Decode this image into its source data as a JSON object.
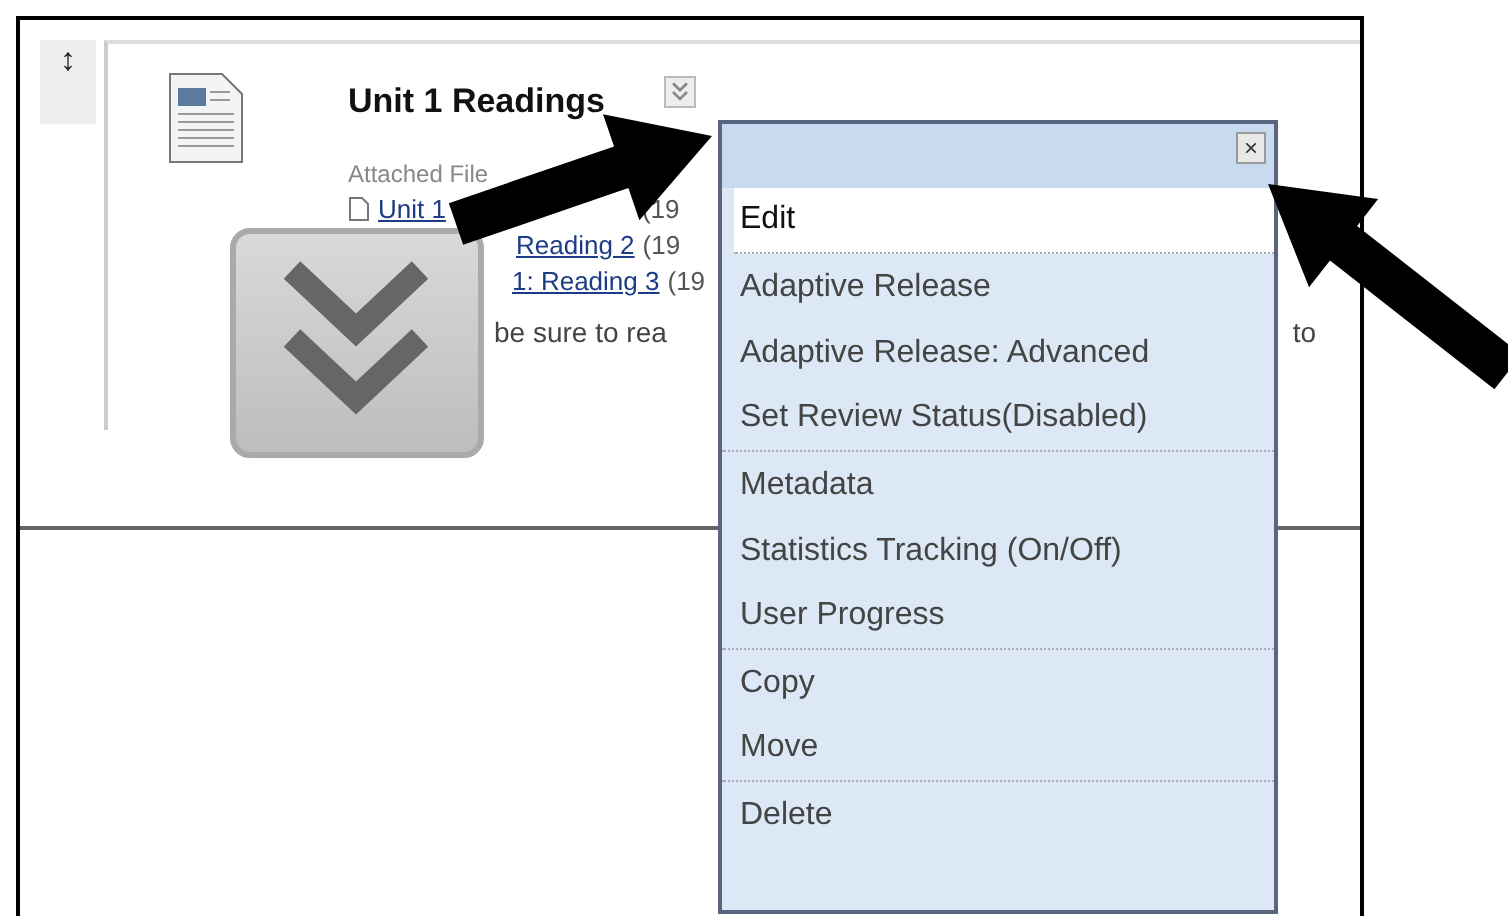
{
  "item": {
    "handle": "↕",
    "title": "Unit 1 Readings",
    "attached_label": "Attached File",
    "files": [
      {
        "name": "Unit 1",
        "size": "(19"
      },
      {
        "name": "Reading 2",
        "size": "(19"
      },
      {
        "name": "1: Reading 3",
        "size": "(19"
      }
    ],
    "description": "be sure to rea",
    "description_tail": "to"
  },
  "menu": {
    "close": "×",
    "items": [
      {
        "label": "Edit",
        "selected": true,
        "separator_after": true
      },
      {
        "label": "Adaptive Release",
        "selected": false,
        "separator_after": false
      },
      {
        "label": "Adaptive Release: Advanced",
        "selected": false,
        "separator_after": false
      },
      {
        "label": "Set Review Status(Disabled)",
        "selected": false,
        "separator_after": true
      },
      {
        "label": "Metadata",
        "selected": false,
        "separator_after": false
      },
      {
        "label": "Statistics Tracking (On/Off)",
        "selected": false,
        "separator_after": false
      },
      {
        "label": "User Progress",
        "selected": false,
        "separator_after": true
      },
      {
        "label": "Copy",
        "selected": false,
        "separator_after": false
      },
      {
        "label": "Move",
        "selected": false,
        "separator_after": true
      },
      {
        "label": "Delete",
        "selected": false,
        "separator_after": false
      }
    ]
  }
}
